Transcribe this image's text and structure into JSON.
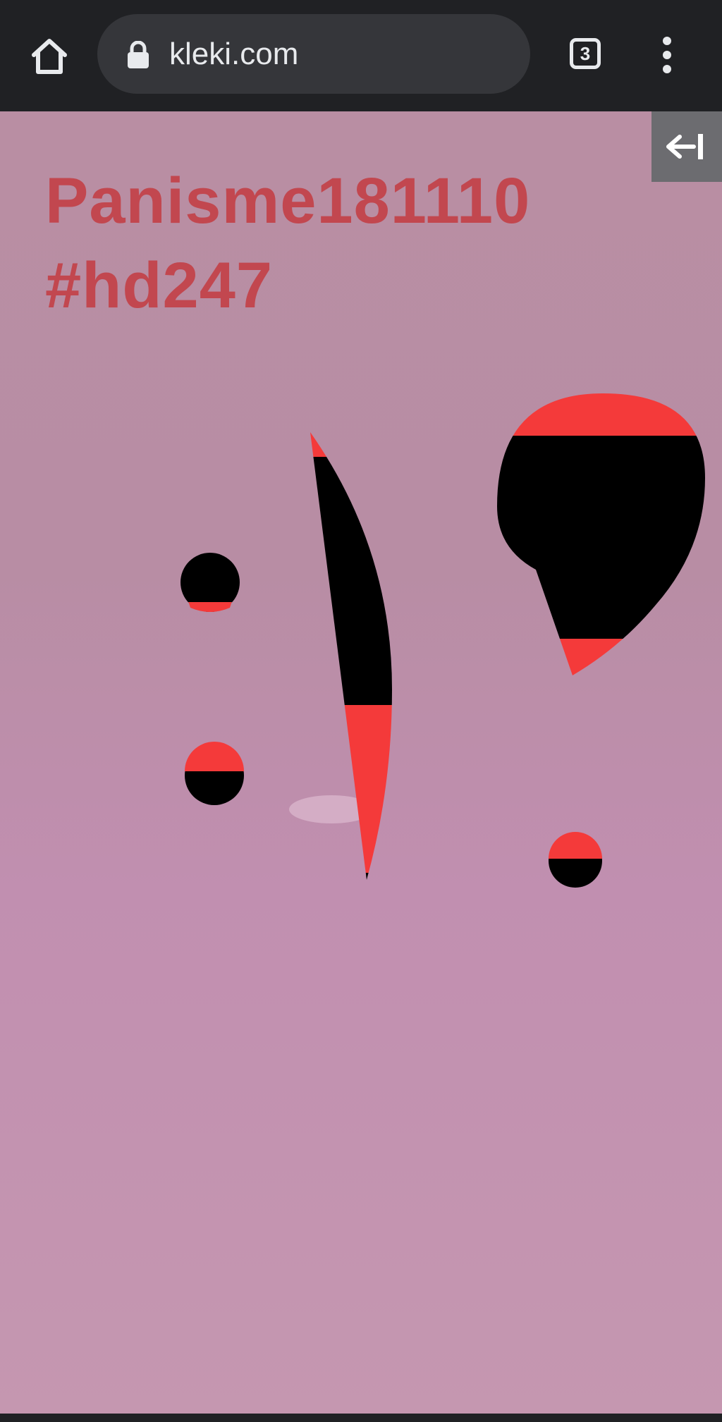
{
  "browser": {
    "url": "kleki.com",
    "tab_count": "3"
  },
  "canvas": {
    "title_line1": "Panisme181110",
    "title_line2": "#hd247"
  },
  "icons": {
    "home": "home-icon",
    "lock": "lock-icon",
    "tabs": "tab-switcher-icon",
    "menu": "more-vert-icon",
    "collapse": "collapse-panel-icon"
  },
  "colors": {
    "toolbar_bg": "#202124",
    "url_box_bg": "#35363a",
    "canvas_bg": "#c394ad",
    "title_text": "#c2474f",
    "stroke_red": "#f43a3a",
    "stroke_black": "#000000",
    "collapse_button_bg": "#6c6c70"
  }
}
